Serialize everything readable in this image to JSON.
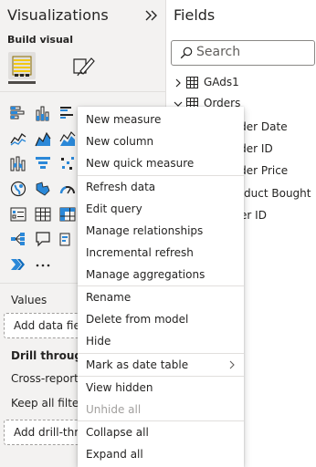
{
  "visualizations": {
    "title": "Visualizations",
    "build_visual_label": "Build visual",
    "icons": [
      "stacked-bar-chart-icon",
      "stacked-column-chart-icon",
      "clustered-bar-chart-icon",
      "clustered-column-chart-icon",
      "line-chart-icon",
      "area-chart-icon",
      "stacked-area-chart-icon",
      "ribbon-chart-icon",
      "funnel-icon",
      "scatter-chart-icon",
      "map-icon",
      "filled-map-icon",
      "gauge-icon",
      "slicer-icon",
      "table-icon",
      "matrix-icon",
      "decomposition-tree-icon",
      "qna-icon",
      "key-influencers-icon",
      "power-automate-icon",
      "more-visuals-icon"
    ],
    "values_label": "Values",
    "add_data_fields": "Add data fields here",
    "drill_through_label": "Drill through",
    "cross_report_label": "Cross-report",
    "keep_all_filters_label": "Keep all filters",
    "add_drill_through": "Add drill-through fields here"
  },
  "fields": {
    "title": "Fields",
    "search_placeholder": "Search",
    "tables": [
      {
        "name": "GAds1",
        "expanded": false
      },
      {
        "name": "Orders",
        "expanded": true
      }
    ],
    "order_fields": [
      "Order Date",
      "Order ID",
      "Order Price",
      "Product Bought",
      "User ID"
    ]
  },
  "context_menu": {
    "items": [
      {
        "label": "New measure",
        "disabled": false
      },
      {
        "label": "New column",
        "disabled": false
      },
      {
        "label": "New quick measure",
        "disabled": false
      },
      {
        "label": "Refresh data",
        "disabled": false
      },
      {
        "label": "Edit query",
        "disabled": false
      },
      {
        "label": "Manage relationships",
        "disabled": false
      },
      {
        "label": "Incremental refresh",
        "disabled": false
      },
      {
        "label": "Manage aggregations",
        "disabled": false
      },
      {
        "label": "Rename",
        "disabled": false
      },
      {
        "label": "Delete from model",
        "disabled": false
      },
      {
        "label": "Hide",
        "disabled": false
      },
      {
        "label": "Mark as date table",
        "disabled": false,
        "submenu": true
      },
      {
        "label": "View hidden",
        "disabled": false
      },
      {
        "label": "Unhide all",
        "disabled": true
      },
      {
        "label": "Collapse all",
        "disabled": false
      },
      {
        "label": "Expand all",
        "disabled": false
      }
    ]
  },
  "colors": {
    "pane_bg": "#f3f2f1",
    "icon_blue": "#2b88d8",
    "icon_dark": "#252423",
    "disabled_text": "#a19f9d"
  }
}
